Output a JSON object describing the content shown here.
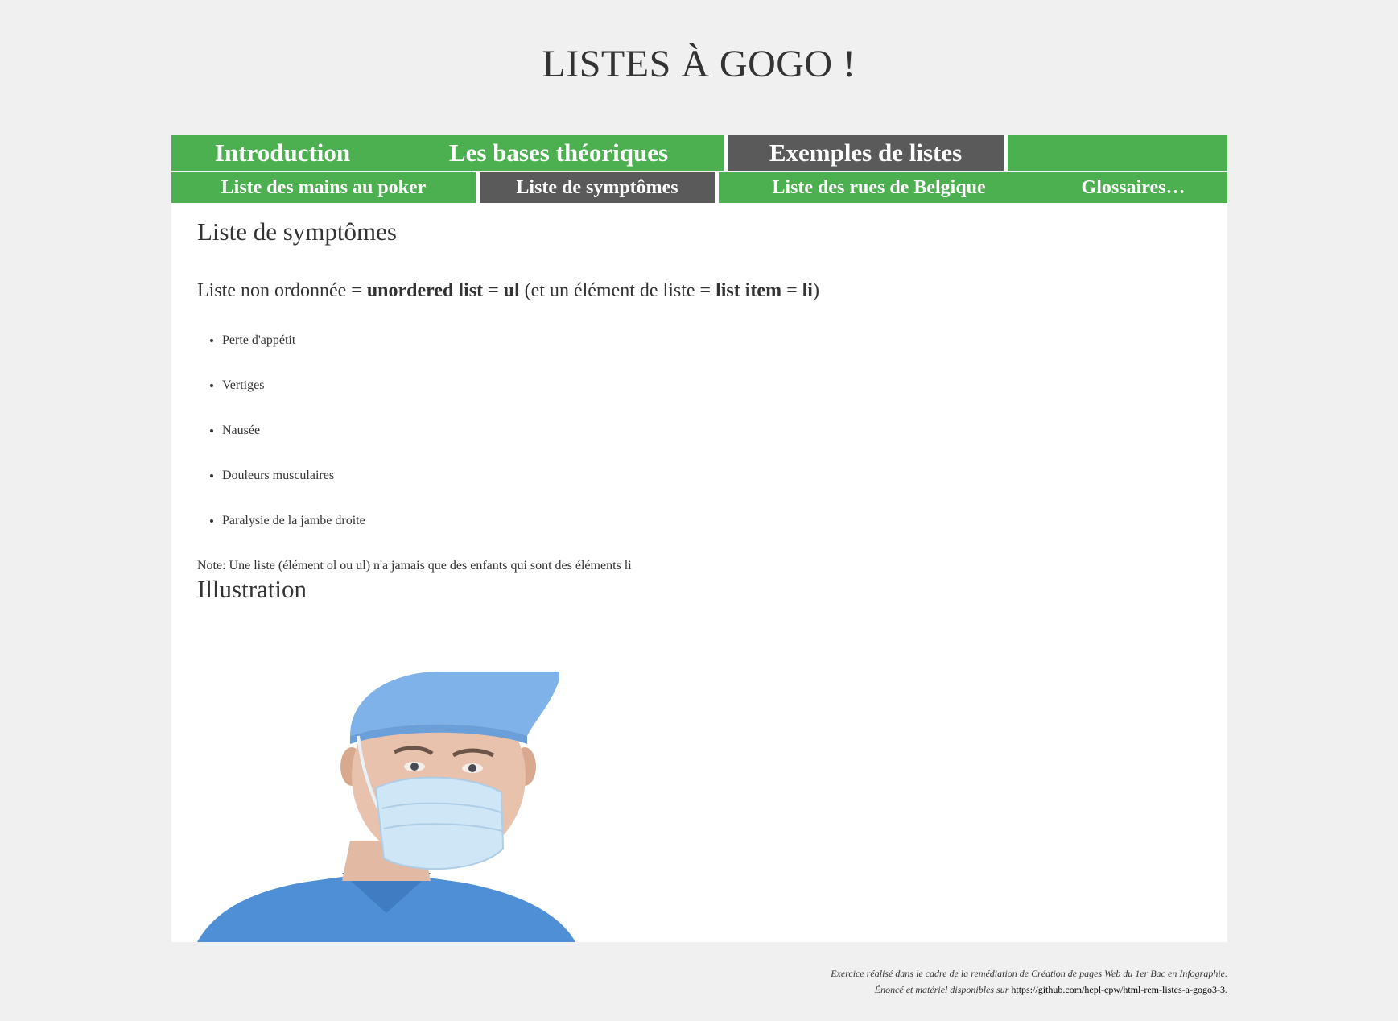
{
  "site_title": "LISTES À GOGO !",
  "nav_primary": [
    {
      "label": "Introduction",
      "active": false
    },
    {
      "label": "Les bases théoriques",
      "active": false
    },
    {
      "label": "Exemples de listes",
      "active": true
    },
    {
      "label": "",
      "active": false
    }
  ],
  "nav_secondary": [
    {
      "label": "Liste des mains au poker",
      "active": false
    },
    {
      "label": "Liste de symptômes",
      "active": true
    },
    {
      "label": "Liste des rues de Belgique",
      "active": false
    },
    {
      "label": "Glossaires…",
      "active": false
    }
  ],
  "main": {
    "heading": "Liste de symptômes",
    "intro": {
      "part1": "Liste non ordonnée = ",
      "b1": "unordered list",
      "part2": " = ",
      "b2": "ul",
      "part3": " (et un élément de liste = ",
      "b3": "list item",
      "part4": " = ",
      "b4": "li",
      "part5": ")"
    },
    "items": [
      "Perte d'appétit",
      "Vertiges",
      "Nausée",
      "Douleurs musculaires",
      "Paralysie de la jambe droite"
    ],
    "note": "Note: Une liste (élément ol ou ul) n'a jamais que des enfants qui sont des éléments li",
    "illustration_heading": "Illustration"
  },
  "footer": {
    "line1": "Exercice réalisé dans le cadre de la remédiation de Création de pages Web du 1er Bac en Infographie.",
    "line2_prefix": "Énoncé et matériel disponibles sur ",
    "link_text": "https://github.com/hepl-cpw/html-rem-listes-a-gogo3-3",
    "line2_suffix": "."
  },
  "colors": {
    "nav_green": "#4caf50",
    "nav_active": "#5a5a5a",
    "page_bg": "#f0f0f0"
  }
}
